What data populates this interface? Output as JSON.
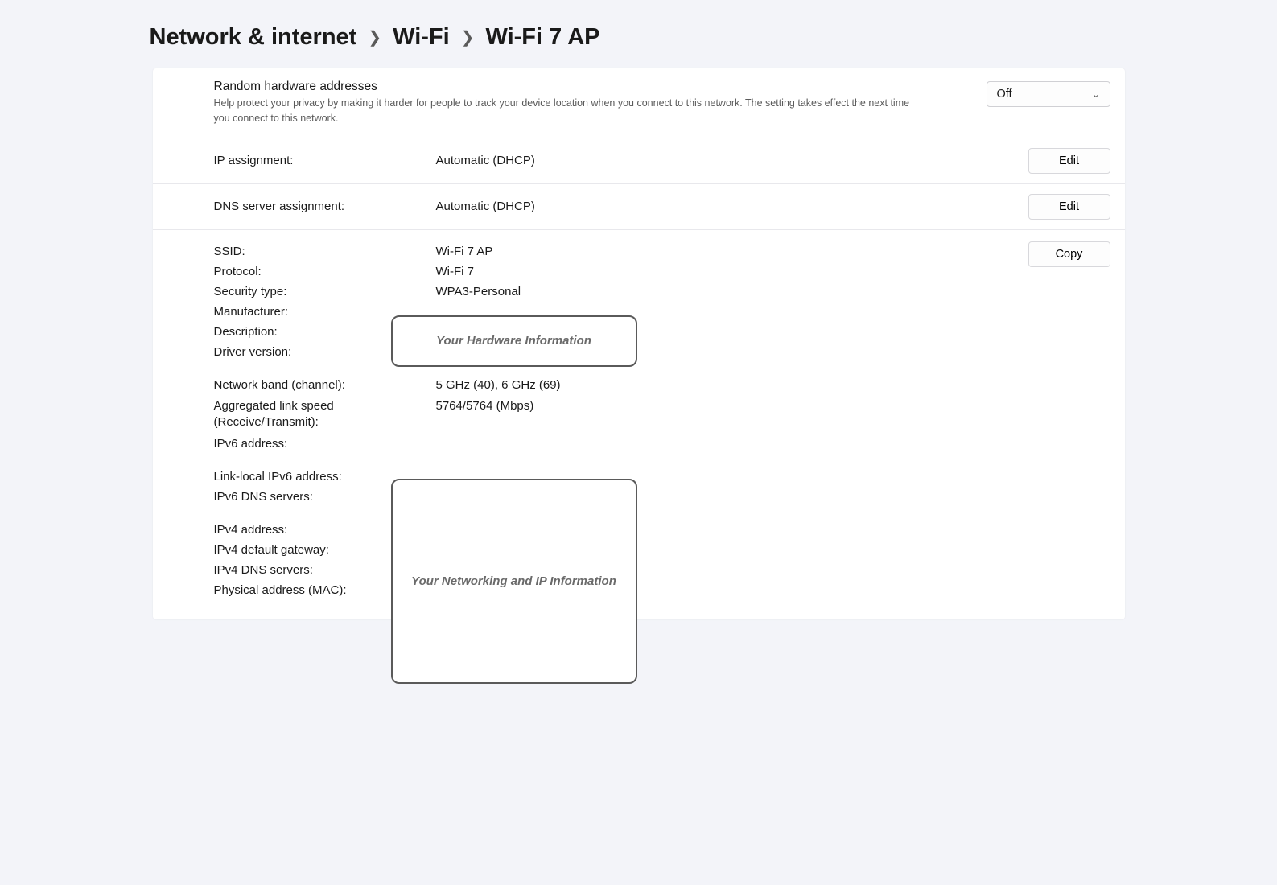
{
  "breadcrumb": {
    "level1": "Network & internet",
    "level2": "Wi-Fi",
    "level3": "Wi-Fi 7 AP"
  },
  "random_hw": {
    "title": "Random hardware addresses",
    "desc": "Help protect your privacy by making it harder for people to track your device location when you connect to this network. The setting takes effect the next time you connect to this network.",
    "dropdown_value": "Off"
  },
  "ip_assignment": {
    "label": "IP assignment:",
    "value": "Automatic (DHCP)",
    "button": "Edit"
  },
  "dns_assignment": {
    "label": "DNS server assignment:",
    "value": "Automatic (DHCP)",
    "button": "Edit"
  },
  "details": {
    "copy_button": "Copy",
    "ssid": {
      "label": "SSID:",
      "value": "Wi-Fi 7 AP"
    },
    "protocol": {
      "label": "Protocol:",
      "value": "Wi-Fi 7"
    },
    "security": {
      "label": "Security type:",
      "value": "WPA3-Personal"
    },
    "manufacturer": {
      "label": "Manufacturer:"
    },
    "description": {
      "label": "Description:"
    },
    "driver": {
      "label": "Driver version:"
    },
    "hw_placeholder": "Your Hardware Information",
    "band": {
      "label": "Network band (channel):",
      "value": "5 GHz (40), 6 GHz (69)"
    },
    "link_speed": {
      "label": "Aggregated link speed (Receive/Transmit):",
      "value": "5764/5764 (Mbps)"
    },
    "ipv6": {
      "label": "IPv6 address:"
    },
    "link_local": {
      "label": "Link-local IPv6 address:"
    },
    "ipv6_dns": {
      "label": "IPv6 DNS servers:"
    },
    "ipv4": {
      "label": "IPv4 address:"
    },
    "ipv4_gw": {
      "label": "IPv4 default gateway:"
    },
    "ipv4_dns": {
      "label": "IPv4 DNS servers:"
    },
    "mac": {
      "label": "Physical address (MAC):"
    },
    "net_placeholder": "Your Networking and IP Information"
  }
}
